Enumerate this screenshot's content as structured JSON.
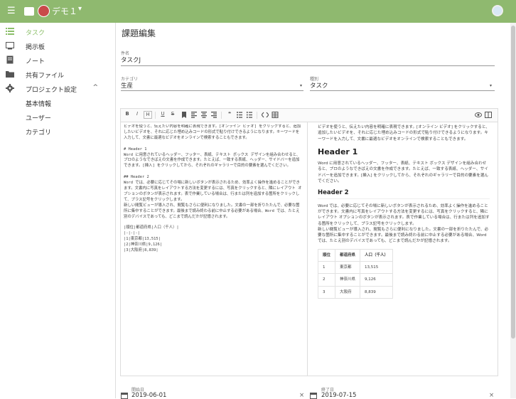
{
  "topbar": {
    "menu_icon": "hamburger-icon",
    "title": "デモ１",
    "caret": "▾"
  },
  "sidebar": {
    "items": [
      {
        "label": "タスク",
        "icon": "list-icon",
        "active": true
      },
      {
        "label": "掲示板",
        "icon": "board-icon"
      },
      {
        "label": "ノート",
        "icon": "note-icon"
      },
      {
        "label": "共有ファイル",
        "icon": "folder-icon"
      },
      {
        "label": "プロジェクト設定",
        "icon": "gear-icon"
      },
      {
        "label": "基本情報"
      },
      {
        "label": "ユーザー"
      },
      {
        "label": "カテゴリ"
      }
    ],
    "chevron": "^"
  },
  "page": {
    "title": "課題編集"
  },
  "form": {
    "name_label": "件名",
    "name_value": "タスクJ",
    "category_label": "カテゴリ",
    "category_value": "生産",
    "type_label": "種別",
    "type_value": "タスク",
    "start_label": "開始日",
    "start_value": "2019-06-01",
    "end_label": "終了日",
    "end_value": "2019-07-15",
    "clear": "×",
    "dropdown": "▾"
  },
  "toolbar": {
    "bold": "B",
    "italic": "I",
    "heading": "H",
    "underline": "U",
    "strike": "S",
    "buttons": [
      "bookmark-icon",
      "align-left-icon",
      "align-center-icon",
      "align-right-icon",
      "quote-icon",
      "list-ul-icon",
      "list-ol-icon",
      "code-icon",
      "table-icon"
    ],
    "quote": "❝"
  },
  "source_text": "ビデオを使うと、伝えたい内容を明確に表現できます。[オンライン ビデオ] をクリックすると、追加したいビデオを、それに応じた埋め込みコードの形式で貼り付けできるようになります。キーワードを入力して、文書に最適なビデオをオンラインで検索することもできます。\n\n# Header 1\nWord に用意されているヘッダー、フッター、表紙、テキスト ボックス デザインを組み合わせると、プロのようなできばえの文書を作成できます。たとえば、一致する表紙、ヘッダー、サイドバーを追加できます。[挿入] をクリックしてから、それぞれのギャラリーで目的の要素を選んでください。\n\n## Header 2\nWord では、必要に応じてその場に新しいボタンが表示されるため、効率よく操作を進めることができます。文書内に写真をレイアウトする方法を変更するには、写真をクリックすると、隣にレイアウト オプションのボタンが表示されます。表で作業している場合は、行または列を追加する箇所をクリックして、プラス記号をクリックします。\n新しい閲覧ビューが導入され、閲覧もさらに便利になりました。文書の一部を折りたたんで、必要な箇所に集中することができます。最後まで読み終わる前に中止する必要がある場合、Word では、たとえ別のデバイスであっても、どこまで読んだかが記憶されます。\n\n|順位|都道府県|人口（千人）|\n|-|-|-|\n|1|東京都|13,515|\n|2|神奈川県|9,126|\n|3|大阪府|8,839|",
  "preview": {
    "p1": "ビデオを使うと、伝えたい内容を明確に表現できます。[オンライン ビデオ] をクリックすると、追加したいビデオを、それに応じた埋め込みコードの形式で貼り付けできるようになります。キーワードを入力して、文書に最適なビデオをオンラインで検索することもできます。",
    "h1": "Header 1",
    "p2": "Word に用意されているヘッダー、フッター、表紙、テキスト ボックス デザインを組み合わせると、プロのようなできばえの文書を作成できます。たとえば、一致する表紙、ヘッダー、サイドバーを追加できます。[挿入] をクリックしてから、それぞれのギャラリーで目的の要素を選んでください。",
    "h2": "Header 2",
    "p3": "Word では、必要に応じてその場に新しいボタンが表示されるため、効率よく操作を進めることができます。文書内に写真をレイアウトする方法を変更するには、写真をクリックすると、隣にレイアウト オプションのボタンが表示されます。表で作業している場合は、行または列を追加する箇所をクリックして、プラス記号をクリックします。",
    "p4": "新しい閲覧ビューが導入され、閲覧もさらに便利になりました。文書の一部を折りたたんで、必要な箇所に集中することができます。最後まで読み終わる前に中止する必要がある場合、Word では、たとえ別のデバイスであっても、どこまで読んだかが記憶されます。",
    "table": {
      "headers": [
        "順位",
        "都道府県",
        "人口（千人）"
      ],
      "rows": [
        [
          "1",
          "東京都",
          "13,515"
        ],
        [
          "2",
          "神奈川県",
          "9,126"
        ],
        [
          "3",
          "大阪府",
          "8,839"
        ]
      ]
    }
  },
  "colors": {
    "topbar": "#8fb96f",
    "accent": "#8cbf6a"
  }
}
